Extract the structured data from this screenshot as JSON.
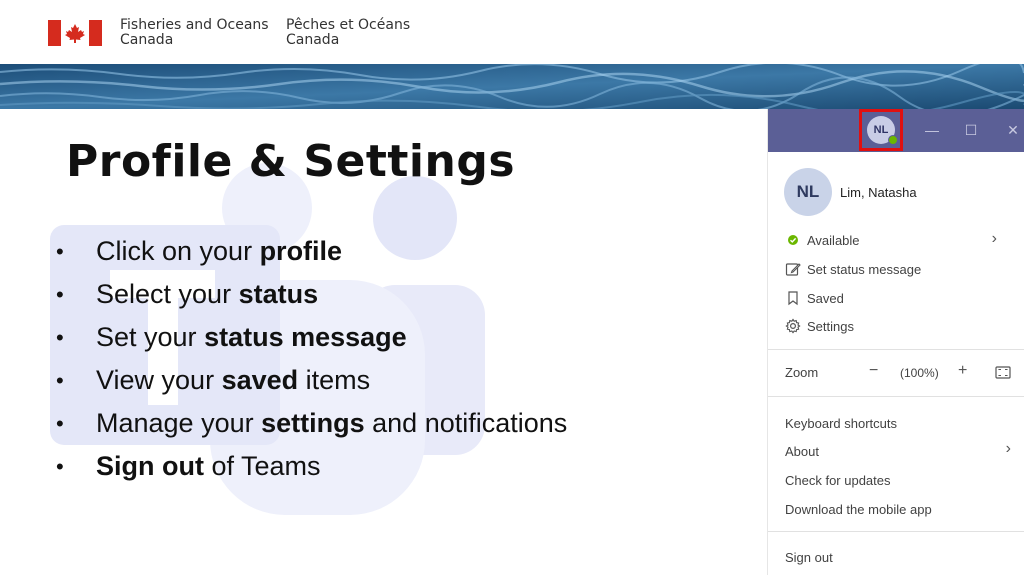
{
  "header": {
    "org_en_line1": "Fisheries and Oceans",
    "org_en_line2": "Canada",
    "org_fr_line1": "Pêches et Océans",
    "org_fr_line2": "Canada"
  },
  "slide": {
    "title": "Profile & Settings",
    "bullets": [
      {
        "pre": "Click on your ",
        "bold": "profile",
        "post": ""
      },
      {
        "pre": "Select your ",
        "bold": "status",
        "post": ""
      },
      {
        "pre": "Set your ",
        "bold": "status message",
        "post": ""
      },
      {
        "pre": "View your ",
        "bold": "saved",
        "post": " items"
      },
      {
        "pre": "Manage your ",
        "bold": "settings",
        "post": " and notifications"
      },
      {
        "pre": "",
        "bold": "Sign out",
        "post": " of Teams"
      }
    ]
  },
  "teams_panel": {
    "titlebar_initials": "NL",
    "titlebar_minimize": "—",
    "titlebar_maximize": "☐",
    "titlebar_close": "✕",
    "avatar_initials": "NL",
    "user_name": "Lim, Natasha",
    "status_label": "Available",
    "set_status_label": "Set status message",
    "saved_label": "Saved",
    "settings_label": "Settings",
    "zoom_label": "Zoom",
    "zoom_minus": "−",
    "zoom_value": "(100%)",
    "zoom_plus": "+",
    "keyboard_shortcuts_label": "Keyboard shortcuts",
    "about_label": "About",
    "check_updates_label": "Check for updates",
    "download_mobile_label": "Download the mobile app",
    "sign_out_label": "Sign out",
    "chevron": "›",
    "icons": [
      "available-presence-icon",
      "edit-status-icon",
      "bookmark-icon",
      "gear-icon",
      "fit-to-window-icon"
    ],
    "colors": {
      "titlebar": "#5b5f96",
      "presence": "#6bb700",
      "highlight": "#e01010"
    }
  }
}
